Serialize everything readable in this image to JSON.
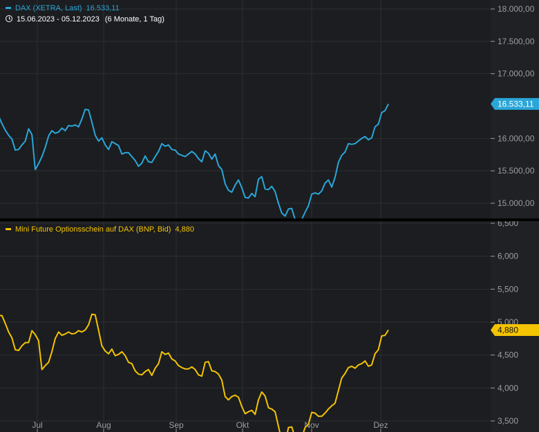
{
  "colors": {
    "background": "#1b1d20",
    "grid": "#2c2f33",
    "axis_panel": "#1f2124",
    "separator": "#000000",
    "dax": "#2aa6d8",
    "mini": "#f5c400",
    "axis_text": "#9a9ea3",
    "range_text": "#ffffff"
  },
  "legend": {
    "top_label": "DAX (XETRA, Last)",
    "top_value": "16.533,11",
    "date_range": "15.06.2023 - 05.12.2023",
    "range_detail": "(6 Monate, 1 Tag)",
    "bottom_label": "Mini Future Optionsschein auf DAX (BNP, Bid)",
    "bottom_value": "4,880"
  },
  "chart_data": [
    {
      "type": "line",
      "name": "DAX (XETRA, Last)",
      "y_axis_labels": [
        "18.000,00",
        "17.500,00",
        "17.000,00",
        "16.000,00",
        "15.500,00",
        "15.000,00"
      ],
      "ylim": [
        14750,
        18050
      ],
      "last_value_label": "16.533,11",
      "last_value": 16533.11,
      "series": [
        {
          "name": "DAX (XETRA, Last)",
          "values": [
            16350,
            16230,
            16130,
            16050,
            15990,
            15820,
            15830,
            15900,
            15960,
            16150,
            16060,
            15520,
            15610,
            15720,
            15860,
            16040,
            16120,
            16080,
            16100,
            16160,
            16120,
            16200,
            16190,
            16210,
            16180,
            16300,
            16450,
            16440,
            16250,
            16050,
            15960,
            16010,
            15900,
            15830,
            15950,
            15920,
            15890,
            15760,
            15780,
            15780,
            15720,
            15660,
            15570,
            15620,
            15730,
            15640,
            15630,
            15720,
            15800,
            15920,
            15880,
            15900,
            15830,
            15820,
            15760,
            15740,
            15720,
            15760,
            15800,
            15760,
            15690,
            15640,
            15810,
            15770,
            15680,
            15760,
            15580,
            15520,
            15300,
            15200,
            15170,
            15280,
            15360,
            15240,
            15090,
            15080,
            15150,
            15100,
            15370,
            15410,
            15220,
            15210,
            15260,
            15180,
            15000,
            14850,
            14800,
            14910,
            14920,
            14750,
            14680,
            14750,
            14860,
            14960,
            15140,
            15160,
            15140,
            15190,
            15310,
            15360,
            15250,
            15400,
            15630,
            15740,
            15790,
            15920,
            15910,
            15920,
            15960,
            16000,
            16030,
            15980,
            16010,
            16180,
            16220,
            16400,
            16430,
            16533
          ]
        }
      ]
    },
    {
      "type": "line",
      "name": "Mini Future Optionsschein auf DAX (BNP, Bid)",
      "y_axis_labels": [
        "6,500",
        "6,000",
        "5,500",
        "5,000",
        "4,500",
        "4,000",
        "3,500"
      ],
      "ylim": [
        3450,
        6520
      ],
      "last_value_label": "4,880",
      "last_value": 4.88,
      "x_tick_labels": [
        "Jul",
        "Aug",
        "Sep",
        "Okt",
        "Nov",
        "Dez"
      ],
      "series": [
        {
          "name": "Mini Future Optionsschein auf DAX (BNP, Bid)",
          "values": [
            5100,
            5100,
            4980,
            4850,
            4760,
            4580,
            4570,
            4640,
            4690,
            4690,
            4870,
            4810,
            4720,
            4280,
            4340,
            4390,
            4550,
            4750,
            4850,
            4800,
            4820,
            4850,
            4820,
            4830,
            4870,
            4850,
            4880,
            4960,
            5120,
            5110,
            4880,
            4640,
            4560,
            4520,
            4590,
            4490,
            4510,
            4550,
            4490,
            4390,
            4370,
            4260,
            4210,
            4200,
            4250,
            4280,
            4190,
            4300,
            4370,
            4550,
            4510,
            4530,
            4440,
            4410,
            4340,
            4310,
            4290,
            4290,
            4320,
            4280,
            4200,
            4180,
            4390,
            4400,
            4260,
            4250,
            4210,
            4120,
            3870,
            3820,
            3870,
            3890,
            3860,
            3720,
            3610,
            3640,
            3660,
            3600,
            3820,
            3940,
            3880,
            3700,
            3680,
            3640,
            3420,
            3200,
            3150,
            3400,
            3410,
            3250,
            3160,
            3250,
            3400,
            3450,
            3630,
            3620,
            3570,
            3570,
            3620,
            3680,
            3730,
            3770,
            3960,
            4150,
            4220,
            4310,
            4330,
            4300,
            4350,
            4370,
            4410,
            4330,
            4350,
            4520,
            4580,
            4790,
            4800,
            4880
          ]
        }
      ]
    }
  ]
}
